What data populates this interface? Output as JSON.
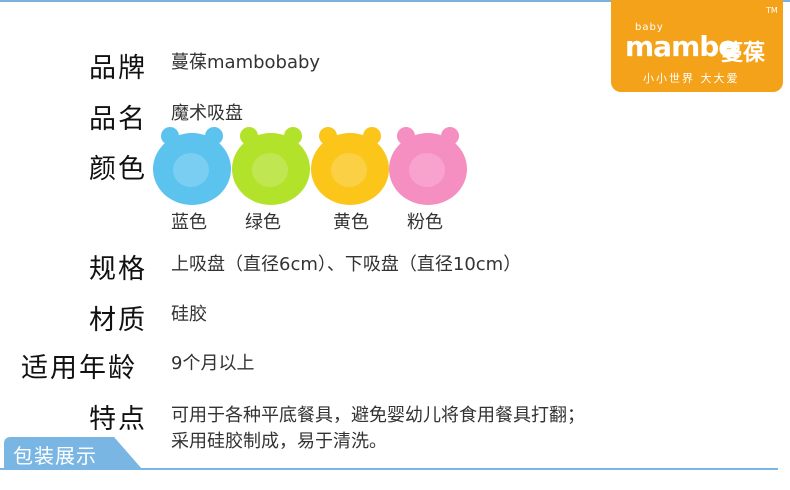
{
  "logo": {
    "small": "baby",
    "brand_latin": "mambo",
    "brand_cn": "蔓葆",
    "tm": "TM",
    "slogan": "小小世界 大大爱",
    "color": "#f5a21b"
  },
  "specs": {
    "brand": {
      "label": "品牌",
      "value": "蔓葆mambobaby"
    },
    "name": {
      "label": "品名",
      "value": "魔术吸盘"
    },
    "color": {
      "label": "颜色"
    },
    "size": {
      "label": "规格",
      "value": "上吸盘（直径6cm）、下吸盘（直径10cm）"
    },
    "material": {
      "label": "材质",
      "value": "硅胶"
    },
    "age": {
      "label": "适用年龄",
      "value": "9个月以上"
    },
    "features": {
      "label": "特点",
      "line1": "可用于各种平底餐具，避免婴幼儿将食用餐具打翻；",
      "line2": "采用硅胶制成，易于清洗。"
    }
  },
  "swatches": [
    {
      "name": "蓝色",
      "hex": "#5bc3ee"
    },
    {
      "name": "绿色",
      "hex": "#b2e22a"
    },
    {
      "name": "黄色",
      "hex": "#fbc519"
    },
    {
      "name": "粉色",
      "hex": "#f58ec1"
    }
  ],
  "footer": {
    "tab": "包装展示",
    "color": "#7ab6e3"
  }
}
